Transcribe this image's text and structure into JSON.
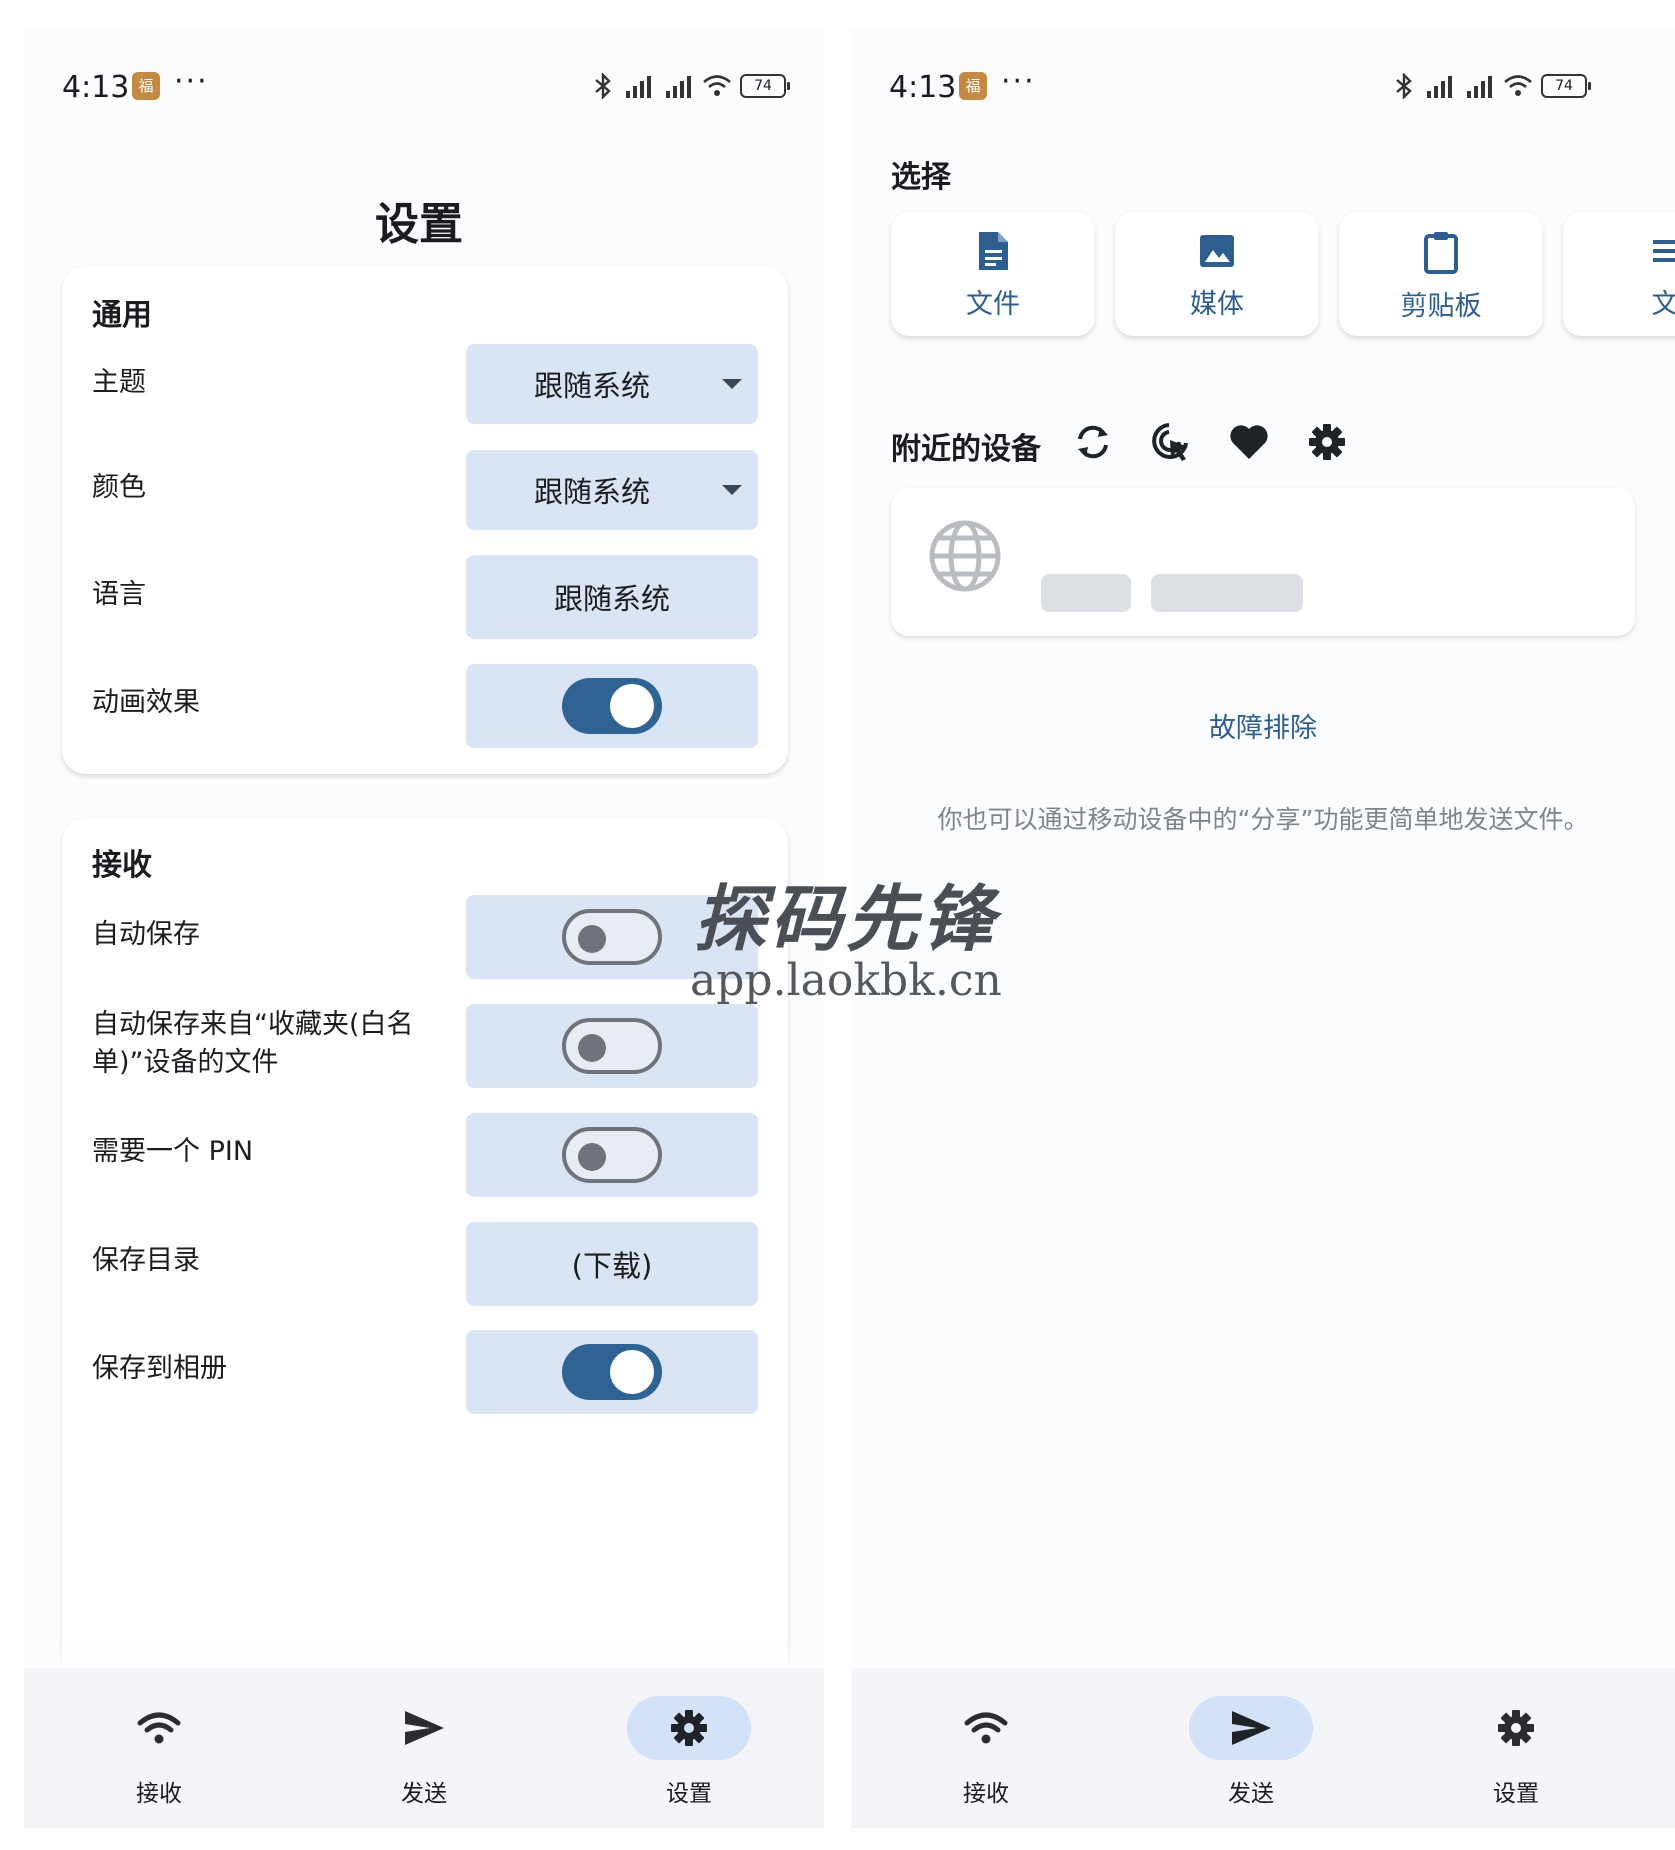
{
  "status_bar": {
    "time": "4:13",
    "notif_badge": "福",
    "more": "···",
    "battery": "74"
  },
  "settings": {
    "page_title": "设置",
    "general": {
      "title": "通用",
      "rows": [
        {
          "label": "主题",
          "value": "跟随系统"
        },
        {
          "label": "颜色",
          "value": "跟随系统"
        },
        {
          "label": "语言",
          "value": "跟随系统"
        },
        {
          "label": "动画效果",
          "on": true
        }
      ]
    },
    "receive": {
      "title": "接收",
      "rows": [
        {
          "label": "自动保存",
          "on": false
        },
        {
          "label": "自动保存来自“收藏夹(白名单)”设备的文件",
          "on": false
        },
        {
          "label": "需要一个 PIN",
          "on": false
        },
        {
          "label": "保存目录",
          "value": "(下载)"
        },
        {
          "label": "保存到相册",
          "on": true
        }
      ]
    }
  },
  "send": {
    "select_title": "选择",
    "tiles": [
      {
        "label": "文件",
        "icon": "file-icon"
      },
      {
        "label": "媒体",
        "icon": "image-icon"
      },
      {
        "label": "剪贴板",
        "icon": "clipboard-icon"
      },
      {
        "label": "文",
        "icon": "text-icon"
      }
    ],
    "nearby_title": "附近的设备",
    "nearby_icons": [
      "refresh-icon",
      "scan-icon",
      "favorites-icon",
      "gear-icon"
    ],
    "troubleshoot": "故障排除",
    "hint": "你也可以通过移动设备中的“分享”功能更简单地发送文件。"
  },
  "nav": [
    {
      "label": "接收",
      "icon": "wifi-icon"
    },
    {
      "label": "发送",
      "icon": "send-icon"
    },
    {
      "label": "设置",
      "icon": "gear-icon"
    }
  ],
  "nav_active": {
    "left": "设置",
    "right": "发送"
  },
  "watermark": {
    "title": "探码先锋",
    "url": "app.laokbk.cn"
  },
  "colors": {
    "accent": "#2f6394",
    "control_bg": "#d9e5f4",
    "link": "#2e5e8e",
    "nav_active_bg": "#d2e3f8"
  }
}
